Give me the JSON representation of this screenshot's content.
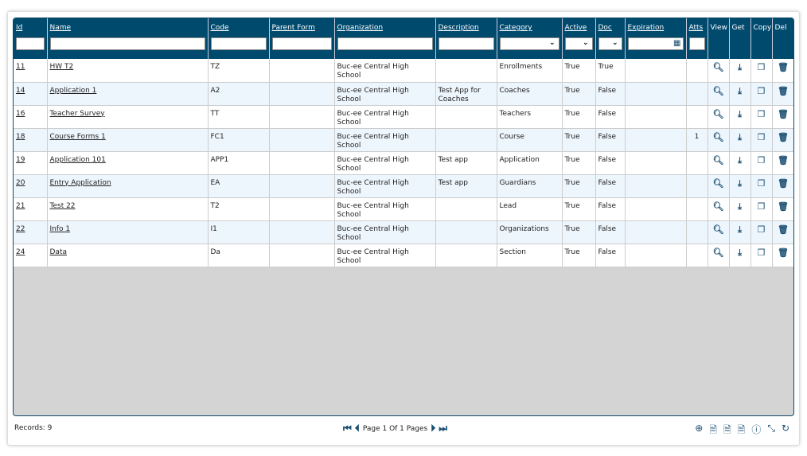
{
  "columns": [
    {
      "label": "Id",
      "link": true,
      "filter": "text"
    },
    {
      "label": "Name",
      "link": true,
      "filter": "text"
    },
    {
      "label": "Code",
      "link": true,
      "filter": "text"
    },
    {
      "label": "Parent Form",
      "link": true,
      "filter": "text"
    },
    {
      "label": "Organization",
      "link": true,
      "filter": "text"
    },
    {
      "label": "Description",
      "link": true,
      "filter": "text"
    },
    {
      "label": "Category",
      "link": true,
      "filter": "select"
    },
    {
      "label": "Active",
      "link": true,
      "filter": "select"
    },
    {
      "label": "Doc",
      "link": true,
      "filter": "select"
    },
    {
      "label": "Expiration",
      "link": true,
      "filter": "date"
    },
    {
      "label": "Atts",
      "link": true,
      "filter": "text"
    },
    {
      "label": "View",
      "link": false
    },
    {
      "label": "Get",
      "link": false
    },
    {
      "label": "Copy",
      "link": false
    },
    {
      "label": "Del",
      "link": false
    }
  ],
  "rows": [
    {
      "id": "11",
      "name": "HW T2",
      "code": "TZ",
      "parent": "",
      "org": "Buc-ee Central High School",
      "desc": "",
      "category": "Enrollments",
      "active": "True",
      "doc": "True",
      "expiration": "",
      "atts": ""
    },
    {
      "id": "14",
      "name": "Application 1",
      "code": "A2",
      "parent": "",
      "org": "Buc-ee Central High School",
      "desc": "Test App for Coaches",
      "category": "Coaches",
      "active": "True",
      "doc": "False",
      "expiration": "",
      "atts": ""
    },
    {
      "id": "16",
      "name": "Teacher Survey",
      "code": "TT",
      "parent": "",
      "org": "Buc-ee Central High School",
      "desc": "",
      "category": "Teachers",
      "active": "True",
      "doc": "False",
      "expiration": "",
      "atts": ""
    },
    {
      "id": "18",
      "name": "Course Forms 1",
      "code": "FC1",
      "parent": "",
      "org": "Buc-ee Central High School",
      "desc": "",
      "category": "Course",
      "active": "True",
      "doc": "False",
      "expiration": "",
      "atts": "1"
    },
    {
      "id": "19",
      "name": "Application 101",
      "code": "APP1",
      "parent": "",
      "org": "Buc-ee Central High School",
      "desc": "Test app",
      "category": "Application",
      "active": "True",
      "doc": "False",
      "expiration": "",
      "atts": ""
    },
    {
      "id": "20",
      "name": "Entry Application",
      "code": "EA",
      "parent": "",
      "org": "Buc-ee Central High School",
      "desc": "Test app",
      "category": "Guardians",
      "active": "True",
      "doc": "False",
      "expiration": "",
      "atts": ""
    },
    {
      "id": "21",
      "name": "Test 22",
      "code": "T2",
      "parent": "",
      "org": "Buc-ee Central High School",
      "desc": "",
      "category": "Lead",
      "active": "True",
      "doc": "False",
      "expiration": "",
      "atts": ""
    },
    {
      "id": "22",
      "name": "Info 1",
      "code": "I1",
      "parent": "",
      "org": "Buc-ee Central High School",
      "desc": "",
      "category": "Organizations",
      "active": "True",
      "doc": "False",
      "expiration": "",
      "atts": ""
    },
    {
      "id": "24",
      "name": "Data",
      "code": "Da",
      "parent": "",
      "org": "Buc-ee Central High School",
      "desc": "",
      "category": "Section",
      "active": "True",
      "doc": "False",
      "expiration": "",
      "atts": ""
    }
  ],
  "row_icons": {
    "view": "search-icon",
    "get": "download-icon",
    "copy": "copy-icon",
    "del": "trash-icon"
  },
  "footer": {
    "records": "Records: 9",
    "page_text": "Page 1 Of 1 Pages"
  },
  "tools": [
    "add-icon",
    "excel-export-icon",
    "excel-export-icon",
    "excel-export-icon",
    "help-icon",
    "collapse-icon",
    "refresh-icon"
  ],
  "colors": {
    "header": "#004a6e",
    "alt_row": "#eef6fd",
    "empty_area": "#d4d4d4"
  }
}
